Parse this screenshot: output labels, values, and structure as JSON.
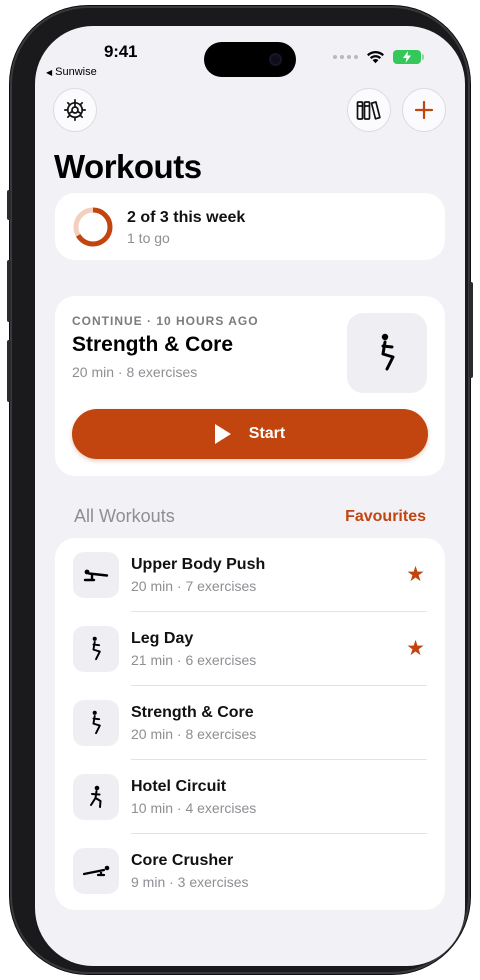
{
  "status_bar": {
    "time": "9:41",
    "back_app": "Sunwise"
  },
  "header": {
    "title": "Workouts"
  },
  "weekly_progress": {
    "title": "2 of 3 this week",
    "subtitle": "1 to go",
    "completed_fraction": 0.667
  },
  "continue_card": {
    "label": "CONTINUE · 10 HOURS AGO",
    "name": "Strength & Core",
    "meta": "20 min · 8 exercises",
    "start_label": "Start"
  },
  "workouts_section": {
    "heading": "All Workouts",
    "favourites_label": "Favourites",
    "items": [
      {
        "name": "Upper Body Push",
        "meta": "20 min · 7 exercises",
        "favourite": true,
        "icon": "pushup-icon"
      },
      {
        "name": "Leg Day",
        "meta": "21 min · 6 exercises",
        "favourite": true,
        "icon": "squat-icon"
      },
      {
        "name": "Strength & Core",
        "meta": "20 min · 8 exercises",
        "favourite": false,
        "icon": "squat-icon"
      },
      {
        "name": "Hotel Circuit",
        "meta": "10 min · 4 exercises",
        "favourite": false,
        "icon": "lunge-icon"
      },
      {
        "name": "Core Crusher",
        "meta": "9 min · 3 exercises",
        "favourite": false,
        "icon": "plank-icon"
      }
    ]
  },
  "colors": {
    "accent": "#c2440f",
    "background": "#f2f1f6",
    "card": "#ffffff"
  },
  "icons": {
    "settings": "gear-icon",
    "library": "library-icon",
    "add": "plus-icon"
  }
}
